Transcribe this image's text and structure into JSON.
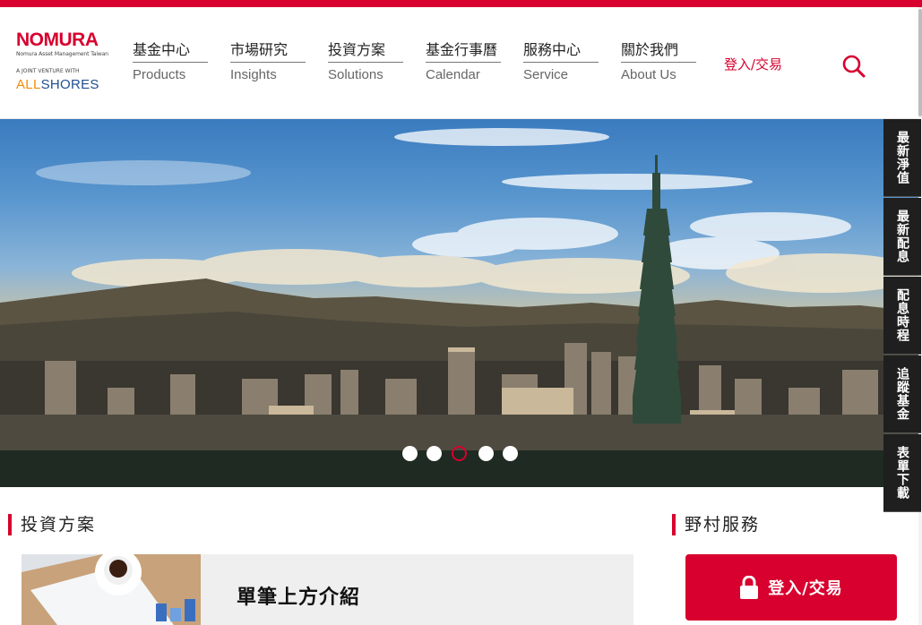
{
  "brand": {
    "name": "NOMURA",
    "subtitle": "Nomura Asset Management Taiwan",
    "jv_text": "A JOINT VENTURE WITH",
    "partner_prefix": "ALL",
    "partner_suffix": "SHORES"
  },
  "nav": {
    "items": [
      {
        "zh": "基金中心",
        "en": "Products"
      },
      {
        "zh": "市場研究",
        "en": "Insights"
      },
      {
        "zh": "投資方案",
        "en": "Solutions"
      },
      {
        "zh": "基金行事曆",
        "en": "Calendar"
      },
      {
        "zh": "服務中心",
        "en": "Service"
      },
      {
        "zh": "關於我們",
        "en": "About Us"
      }
    ],
    "login_label": "登入/交易",
    "search_icon": "search-icon"
  },
  "side_tabs": [
    "最新淨值",
    "最新配息",
    "配息時程",
    "追蹤基金",
    "表單下載"
  ],
  "carousel": {
    "count": 5,
    "active_index": 2
  },
  "investment": {
    "section_title": "投資方案",
    "card_title": "單筆上方介紹"
  },
  "service": {
    "section_title": "野村服務",
    "login_button": "登入/交易",
    "login_icon": "lock-icon"
  },
  "colors": {
    "brand_red": "#d7002e",
    "side_tab_bg": "#1f1f1f"
  }
}
